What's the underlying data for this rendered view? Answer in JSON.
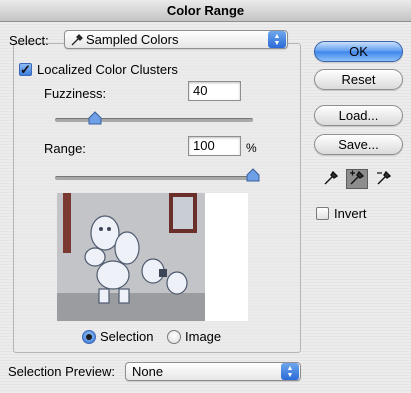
{
  "window": {
    "title": "Color Range"
  },
  "select": {
    "label": "Select:",
    "value": "Sampled Colors",
    "icon": "eyedropper-icon"
  },
  "localized_clusters": {
    "label": "Localized Color Clusters",
    "checked": true
  },
  "fuzziness": {
    "label": "Fuzziness:",
    "value": "40",
    "fraction": 0.2
  },
  "range": {
    "label": "Range:",
    "value": "100",
    "unit": "%",
    "fraction": 1.0
  },
  "view": {
    "selection_label": "Selection",
    "image_label": "Image",
    "selected": "selection"
  },
  "selection_preview": {
    "label": "Selection Preview:",
    "value": "None"
  },
  "buttons": {
    "ok": "OK",
    "reset": "Reset",
    "load": "Load...",
    "save": "Save..."
  },
  "tools": {
    "eyedropper": "eyedropper-icon",
    "add": "eyedropper-plus-icon",
    "subtract": "eyedropper-minus-icon",
    "selected": "add"
  },
  "invert": {
    "label": "Invert",
    "checked": false
  },
  "colors": {
    "accent": "#3d84ea",
    "window_bg": "#ececec"
  }
}
